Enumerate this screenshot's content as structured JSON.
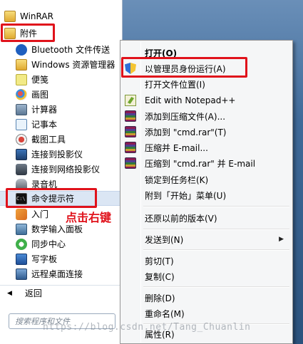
{
  "programs_list": {
    "items": [
      {
        "label": "WinRAR",
        "icon": "folder-icon"
      },
      {
        "label": "附件",
        "icon": "folder-icon"
      },
      {
        "label": "Bluetooth 文件传送",
        "icon": "bluetooth-icon"
      },
      {
        "label": "Windows 资源管理器",
        "icon": "explorer-icon"
      },
      {
        "label": "便笺",
        "icon": "sticky-notes-icon"
      },
      {
        "label": "画图",
        "icon": "paint-icon"
      },
      {
        "label": "计算器",
        "icon": "calculator-icon"
      },
      {
        "label": "记事本",
        "icon": "notepad-icon"
      },
      {
        "label": "截图工具",
        "icon": "snipping-tool-icon"
      },
      {
        "label": "连接到投影仪",
        "icon": "projector-icon"
      },
      {
        "label": "连接到网络投影仪",
        "icon": "network-projector-icon"
      },
      {
        "label": "录音机",
        "icon": "sound-recorder-icon"
      },
      {
        "label": "命令提示符",
        "icon": "cmd-icon"
      },
      {
        "label": "入门",
        "icon": "getting-started-icon"
      },
      {
        "label": "数学输入面板",
        "icon": "math-input-icon"
      },
      {
        "label": "同步中心",
        "icon": "sync-center-icon"
      },
      {
        "label": "写字板",
        "icon": "wordpad-icon"
      },
      {
        "label": "远程桌面连接",
        "icon": "remote-desktop-icon"
      }
    ],
    "back_label": "返回",
    "annotation": "点击右键"
  },
  "search": {
    "placeholder": "搜索程序和文件"
  },
  "context_menu": {
    "items": [
      {
        "label": "打开(O)",
        "bold": true
      },
      {
        "label": "以管理员身份运行(A)",
        "icon": "uac-shield-icon"
      },
      {
        "label": "打开文件位置(I)"
      },
      {
        "label": "Edit with Notepad++",
        "icon": "notepad-plus-plus-icon"
      },
      {
        "label": "添加到压缩文件(A)...",
        "icon": "winrar-icon"
      },
      {
        "label": "添加到 \"cmd.rar\"(T)",
        "icon": "winrar-icon"
      },
      {
        "label": "压缩并 E-mail...",
        "icon": "winrar-icon"
      },
      {
        "label": "压缩到 \"cmd.rar\" 并 E-mail",
        "icon": "winrar-icon"
      },
      {
        "label": "锁定到任务栏(K)"
      },
      {
        "label": "附到「开始」菜单(U)"
      },
      {
        "label": "还原以前的版本(V)"
      },
      {
        "label": "发送到(N)",
        "submenu": true
      },
      {
        "label": "剪切(T)"
      },
      {
        "label": "复制(C)"
      },
      {
        "label": "删除(D)"
      },
      {
        "label": "重命名(M)"
      },
      {
        "label": "属性(R)"
      }
    ]
  },
  "watermark": "https://blog.csdn.net/Tang_Chuanlin",
  "colors": {
    "highlight_red": "#e0121b",
    "menu_bg": "#f5f6f7"
  }
}
